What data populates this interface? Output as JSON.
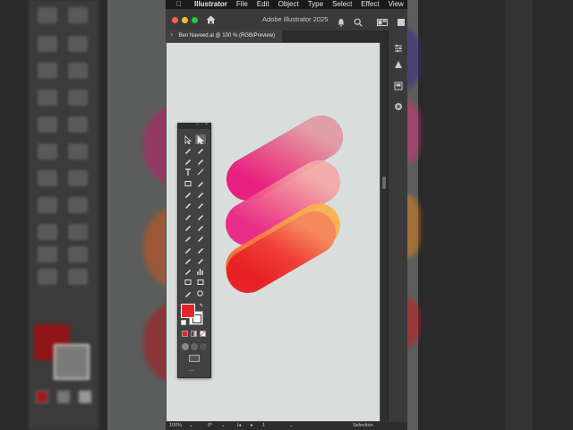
{
  "menubar": {
    "apple": "",
    "items": [
      "Illustrator",
      "File",
      "Edit",
      "Object",
      "Type",
      "Select",
      "Effect",
      "View"
    ]
  },
  "window": {
    "title": "Adobe Illustrator 2025",
    "traffic_lights": [
      "#fe5f57",
      "#febc2e",
      "#28c840"
    ]
  },
  "document_tab": {
    "close": "×",
    "label": "Ben Naveed.ai @ 100 % (RGB/Preview)"
  },
  "statusbar": {
    "zoom": "100%",
    "rotation": "0°",
    "artboard": "1",
    "tool": "Selection"
  },
  "toolbar": {
    "fill_color": "#e5252a",
    "stroke_color": "#ffffff",
    "selected_tool": "direct-selection-tool",
    "more_label": "..."
  },
  "artwork": {
    "shapes": [
      {
        "name": "blue-pill",
        "colors": [
          "#c4206f",
          "#8c2a8e",
          "#353a9a"
        ]
      },
      {
        "name": "pink-pill",
        "colors": [
          "#f0328f",
          "#f0628b",
          "#f3a3a0"
        ]
      },
      {
        "name": "orange-pill",
        "colors": [
          "#f07a2a",
          "#f58e46",
          "#f9a64a"
        ]
      },
      {
        "name": "red-pill",
        "colors": [
          "#ea2328",
          "#f1453b",
          "#f57a5a"
        ]
      }
    ]
  },
  "tools_icons": [
    "selection",
    "direct-selection",
    "magic-wand",
    "lasso",
    "pen",
    "curvature",
    "type",
    "line",
    "rectangle",
    "paintbrush",
    "shaper",
    "pencil",
    "eraser",
    "scissors",
    "rotate",
    "scale",
    "width",
    "free-transform",
    "shape-builder",
    "perspective",
    "mesh",
    "gradient",
    "eyedropper",
    "blend",
    "symbol-sprayer",
    "column-graph",
    "artboard",
    "slice",
    "hand",
    "zoom"
  ]
}
